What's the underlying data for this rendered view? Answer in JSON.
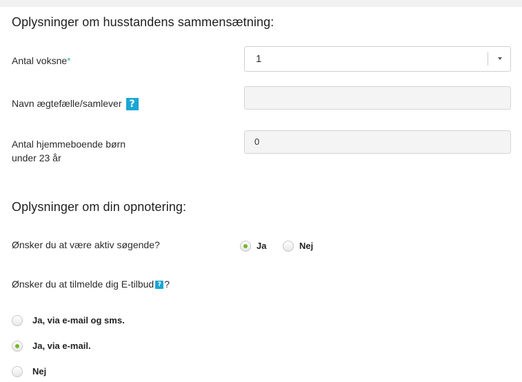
{
  "household": {
    "title": "Oplysninger om husstandens sammensætning:",
    "adults": {
      "label": "Antal voksne",
      "required_mark": "*",
      "value": "1"
    },
    "partner": {
      "label": "Navn ægtefælle/samlever",
      "help_icon": "?",
      "value": ""
    },
    "children": {
      "label_line1": "Antal hjemmeboende børn",
      "label_line2": "under 23 år",
      "value": "0"
    }
  },
  "registration": {
    "title": "Oplysninger om din opnotering:",
    "active_seeker": {
      "question": "Ønsker du at være aktiv søgende?",
      "options": [
        {
          "label": "Ja",
          "selected": true
        },
        {
          "label": "Nej",
          "selected": false
        }
      ]
    },
    "e_offers": {
      "question": "Ønsker du at tilmelde dig E-tilbud",
      "help_icon": "?",
      "question_suffix": "?",
      "options": [
        {
          "label": "Ja, via e-mail og sms.",
          "selected": false
        },
        {
          "label": "Ja, via e-mail.",
          "selected": true
        },
        {
          "label": "Nej",
          "selected": false
        }
      ]
    }
  },
  "colors": {
    "accent_help": "#1aa6d4",
    "required": "#3cb3b3",
    "radio_checked": "#74b82a"
  }
}
